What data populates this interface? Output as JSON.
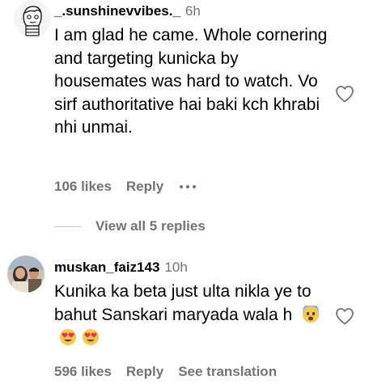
{
  "comments": [
    {
      "username": "_.sunshinevvibes._",
      "time": "6h",
      "text": "I am glad he came. Whole cornering and targeting kunicka by housemates was hard to watch. Vo sirf authoritative hai baki kch khrabi nhi unmai.",
      "likes": "106 likes",
      "reply_label": "Reply",
      "avatar_icon": "sketch-avatar-icon"
    },
    {
      "username": "muskan_faiz143",
      "time": "10h",
      "text": "Kunika ka beta just ulta nikla ye to bahut Sanskari maryada wala h",
      "emojis": [
        "😨",
        "😍",
        "😍"
      ],
      "likes": "596 likes",
      "reply_label": "Reply",
      "translate_label": "See translation",
      "avatar_icon": "photo-avatar-icon"
    }
  ],
  "view_replies_label": "View all 5 replies",
  "colors": {
    "secondary_text": "#737373",
    "primary_text": "#000000",
    "divider": "#c7c7c7"
  }
}
